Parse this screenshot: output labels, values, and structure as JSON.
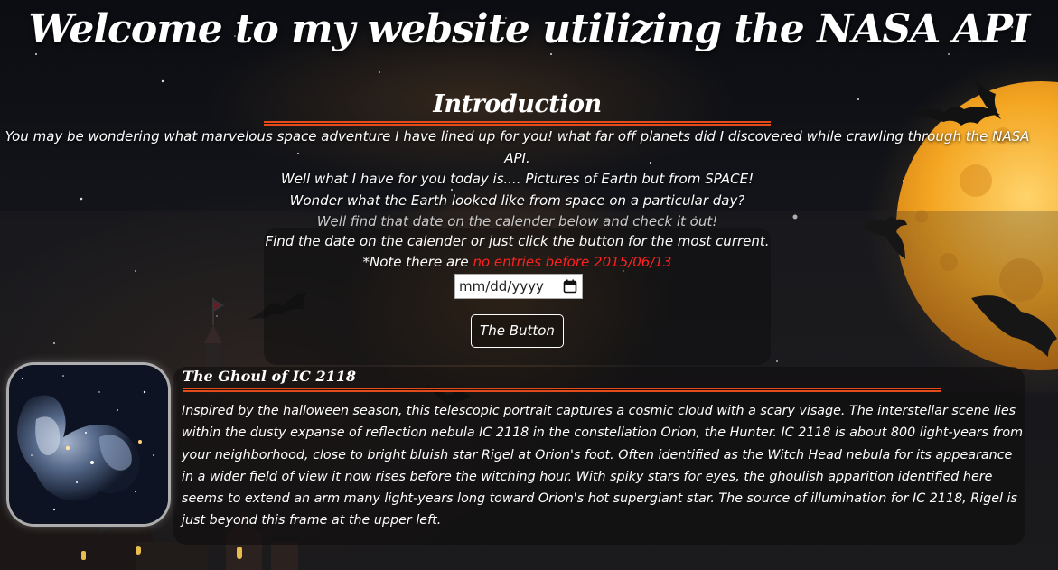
{
  "header": {
    "title": "Welcome to my website utilizing the NASA API"
  },
  "intro": {
    "heading": "Introduction",
    "lines": [
      "You may be wondering what marvelous space adventure I have lined up for you! what far off planets did I discovered while crawling through the NASA API.",
      "Well what I have for you today is.... Pictures of Earth but from SPACE!",
      "Wonder what the Earth looked like from space on a particular day?",
      "Well find that date on the calender below and check it out!"
    ]
  },
  "picker": {
    "instructions": "Find the date on the calender or just click the button for the most current.",
    "note_prefix": "*Note there are",
    "note_highlight": "no entries before 2015/06/13",
    "date_placeholder": "mm/dd/yyyy",
    "button_label": "The Button",
    "highlight_color": "#ff2121"
  },
  "apod": {
    "title": "The Ghoul of IC 2118",
    "description": "Inspired by the halloween season, this telescopic portrait captures a cosmic cloud with a scary visage. The interstellar scene lies within the dusty expanse of reflection nebula IC 2118 in the constellation Orion, the Hunter. IC 2118 is about 800 light-years from your neighborhood, close to bright bluish star Rigel at Orion's foot. Often identified as the Witch Head nebula for its appearance in a wider field of view it now rises before the witching hour. With spiky stars for eyes, the ghoulish apparition identified here seems to extend an arm many light-years long toward Orion's hot supergiant star. The source of illumination for IC 2118, Rigel is just beyond this frame at the upper left."
  },
  "theme": {
    "accent_rule": "#e64a19",
    "moon": "#f0a41e",
    "background": "#0b0c10"
  }
}
